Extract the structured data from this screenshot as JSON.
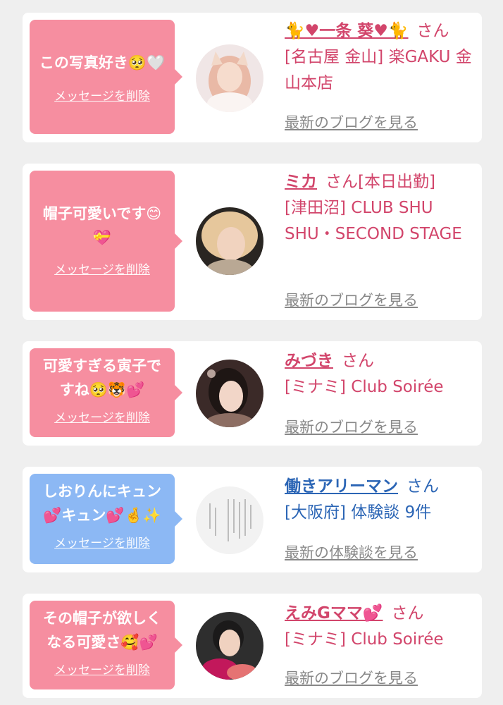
{
  "messages": [
    {
      "bubble_text": "この写真好き🥺🤍",
      "delete_label": "メッセージを削除",
      "name": "🐈♥一条 葵♥🐈",
      "honorific": "さん",
      "shop": "[名古屋 金山] 楽GAKU 金山本店",
      "link": "最新のブログを見る"
    },
    {
      "bubble_text": "帽子可愛いです😊\n💝",
      "delete_label": "メッセージを削除",
      "name": "ミカ",
      "honorific": "さん[本日出勤]",
      "shop": "[津田沼] CLUB SHU SHU・SECOND STAGE",
      "link": "最新のブログを見る"
    },
    {
      "bubble_text": "可愛すぎる寅子で\nすね🥺🐯💕",
      "delete_label": "メッセージを削除",
      "name": "みづき",
      "honorific": "さん",
      "shop": "[ミナミ] Club Soirée",
      "link": "最新のブログを見る"
    },
    {
      "bubble_text": "しおりんにキュン\n💕キュン💕🤞✨",
      "delete_label": "メッセージを削除",
      "name": "働きアリーマン",
      "honorific": "さん",
      "shop": "[大阪府] 体験談 9件",
      "link": "最新の体験談を見る"
    },
    {
      "bubble_text": "その帽子が欲しく\nなる可愛さ🥰💕",
      "delete_label": "メッセージを削除",
      "name": "えみGママ💕",
      "honorific": "さん",
      "shop": "[ミナミ] Club Soirée",
      "link": "最新のブログを見る"
    }
  ],
  "colors": {
    "pink_bubble": "#f68ea0",
    "blue_bubble": "#8cb8f4",
    "pink_text": "#d2456b",
    "blue_text": "#2b65b5",
    "link_gray": "#888888",
    "background": "#efefef"
  }
}
